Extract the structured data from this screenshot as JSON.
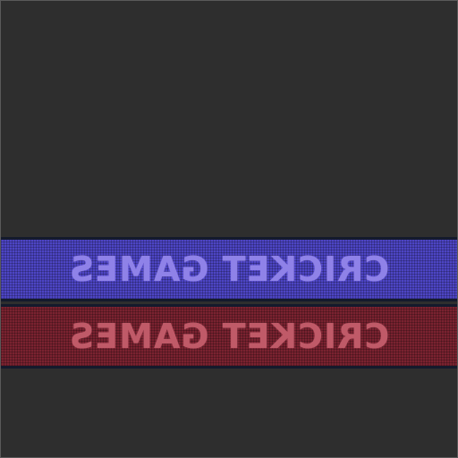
{
  "banners": [
    {
      "label": "CRICKET GAMES",
      "color": "#4d45c4",
      "text_color": "#8f82e8",
      "mirrored": true
    },
    {
      "label": "CRICKET GAMES",
      "color": "#7a2230",
      "text_color": "#c05a68",
      "mirrored": true
    }
  ],
  "background_color": "#2e2e2e"
}
